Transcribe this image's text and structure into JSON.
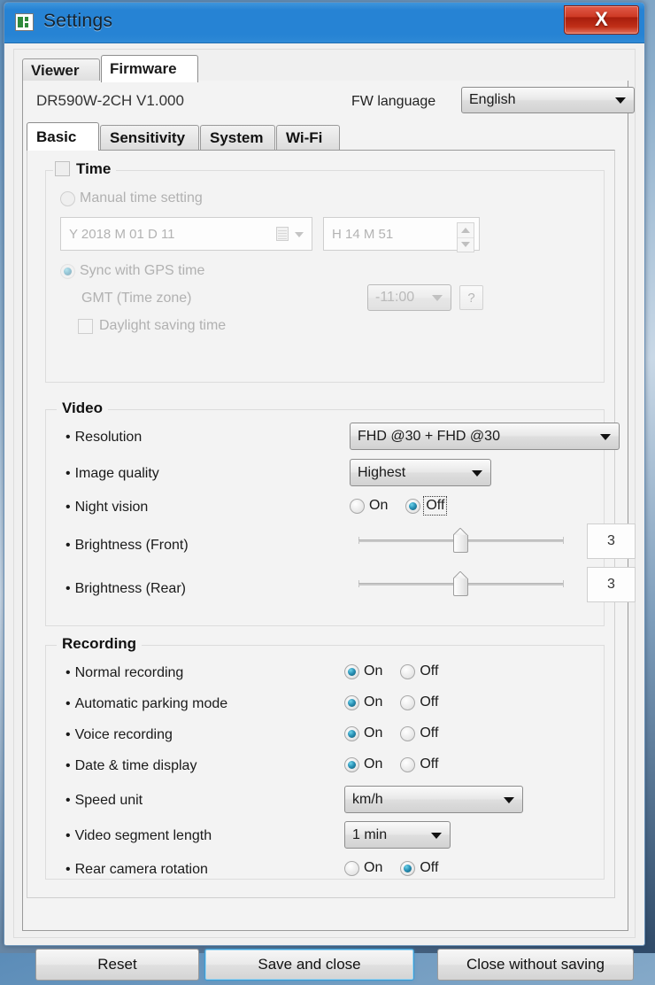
{
  "window": {
    "title": "Settings",
    "icon": "app-window-icon",
    "close_label": "X"
  },
  "outer_tabs": [
    {
      "label": "Viewer",
      "active": false
    },
    {
      "label": "Firmware",
      "active": true
    }
  ],
  "firmware_header": {
    "model": "DR590W-2CH  V1.000",
    "language_label": "FW language",
    "language_value": "English"
  },
  "inner_tabs": [
    {
      "label": "Basic",
      "active": true
    },
    {
      "label": "Sensitivity",
      "active": false
    },
    {
      "label": "System",
      "active": false
    },
    {
      "label": "Wi-Fi",
      "active": false
    }
  ],
  "time_group": {
    "legend": "Time",
    "enabled": false,
    "checked": false,
    "manual_label": "Manual time setting",
    "manual_selected": false,
    "date_value": "Y 2018 M 01 D 11",
    "time_value": "H 14 M 51",
    "gps_label": "Sync with GPS time",
    "gps_selected": true,
    "gmt_label": "GMT (Time zone)",
    "gmt_value": "-11:00",
    "help_label": "?",
    "dst_label": "Daylight saving time",
    "dst_checked": false
  },
  "video_group": {
    "legend": "Video",
    "resolution_label": "Resolution",
    "resolution_value": "FHD @30 + FHD @30",
    "quality_label": "Image quality",
    "quality_value": "Highest",
    "night_label": "Night vision",
    "night_on_label": "On",
    "night_off_label": "Off",
    "night_value": "Off",
    "brightness_front_label": "Brightness (Front)",
    "brightness_front_value": "3",
    "brightness_rear_label": "Brightness (Rear)",
    "brightness_rear_value": "3",
    "slider_min": 1,
    "slider_max": 5
  },
  "recording_group": {
    "legend": "Recording",
    "on_label": "On",
    "off_label": "Off",
    "rows": [
      {
        "label": "Normal recording",
        "value": "On"
      },
      {
        "label": "Automatic parking mode",
        "value": "On"
      },
      {
        "label": "Voice recording",
        "value": "On"
      },
      {
        "label": "Date & time display",
        "value": "On"
      }
    ],
    "speed_unit_label": "Speed unit",
    "speed_unit_value": "km/h",
    "segment_label": "Video segment length",
    "segment_value": "1 min",
    "rear_rotation_label": "Rear camera rotation",
    "rear_rotation_value": "Off"
  },
  "footer": {
    "reset_label": "Reset",
    "save_label": "Save and close",
    "close_label": "Close without saving"
  },
  "colors": {
    "titlebar": "#2683d4",
    "close_button": "#c02f18",
    "radio_selected": "#2a93b8",
    "default_button_outline": "#3c9cd4",
    "body": "#f0f0f0"
  }
}
